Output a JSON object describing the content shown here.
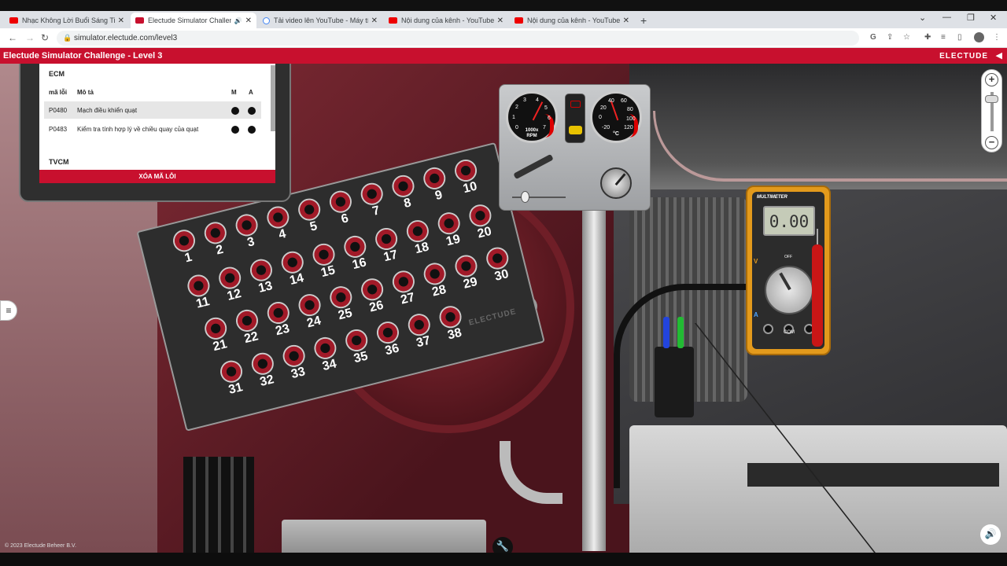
{
  "browser": {
    "tabs": [
      {
        "title": "Nhạc Không Lời Buổi Sáng Tinh T",
        "icon": "youtube-icon",
        "active": false
      },
      {
        "title": "Electude Simulator Challenge -",
        "icon": "electude-icon",
        "active": true,
        "audio": true
      },
      {
        "title": "Tải video lên YouTube - Máy tính",
        "icon": "google-icon",
        "active": false
      },
      {
        "title": "Nội dung của kênh - YouTube Stu",
        "icon": "youtube-icon",
        "active": false
      },
      {
        "title": "Nội dung của kênh - YouTube Stu",
        "icon": "youtube-icon",
        "active": false
      }
    ],
    "new_tab": "+",
    "url": "simulator.electude.com/level3"
  },
  "app": {
    "title": "Electude Simulator Challenge - Level 3",
    "logo": "ELECTUDE",
    "copyright": "© 2023 Electude Beheer B.V."
  },
  "ecm": {
    "section_label": "ECM",
    "col_code": "mã lỗi",
    "col_desc": "Mô tả",
    "col_m": "M",
    "col_a": "A",
    "faults": [
      {
        "code": "P0480",
        "desc": "Mạch điều khiển quạt",
        "m": true,
        "a": true,
        "selected": true
      },
      {
        "code": "P0483",
        "desc": "Kiểm tra tính hợp lý về chiều quay của quạt",
        "m": true,
        "a": true,
        "selected": false
      }
    ],
    "next_section": "TVCM",
    "clear_button": "XÓA MÃ LỖI"
  },
  "breakout_box": {
    "pins": [
      "1",
      "2",
      "3",
      "4",
      "5",
      "6",
      "7",
      "8",
      "9",
      "10",
      "11",
      "12",
      "13",
      "14",
      "15",
      "16",
      "17",
      "18",
      "19",
      "20",
      "21",
      "22",
      "23",
      "24",
      "25",
      "26",
      "27",
      "28",
      "29",
      "30",
      "31",
      "32",
      "33",
      "34",
      "35",
      "36",
      "37",
      "38"
    ],
    "logo": "ELECTUDE"
  },
  "gauges": {
    "rpm": {
      "ticks": [
        "0",
        "1",
        "2",
        "3",
        "4",
        "5",
        "6",
        "7"
      ],
      "unit_line1": "1000x",
      "unit_line2": "RPM",
      "value": 4.2
    },
    "temp": {
      "ticks": [
        "-20",
        "0",
        "20",
        "40",
        "60",
        "80",
        "100",
        "120"
      ],
      "unit": "°C",
      "value": 40
    }
  },
  "multimeter": {
    "brand": "MULTIMETER",
    "reading": "0.00",
    "labels": {
      "v": "V",
      "a": "A",
      "com": "COM",
      "off": "OFF",
      "v_right": "V"
    }
  },
  "colors": {
    "accent": "#c8102e",
    "probe_red": "#c91616",
    "multimeter_body": "#e39a1c",
    "wire_blue": "#2244dd",
    "wire_green": "#22bb33"
  }
}
